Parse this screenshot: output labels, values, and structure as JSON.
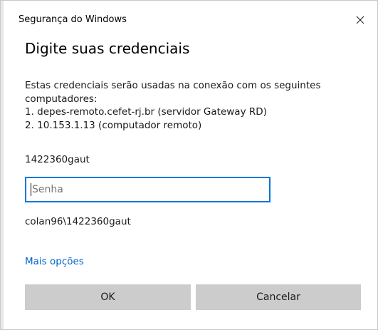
{
  "window": {
    "title": "Segurança do Windows"
  },
  "dialog": {
    "heading": "Digite suas credenciais",
    "message_lines": [
      "Estas credenciais serão usadas na conexão com os seguintes",
      "computadores:",
      "1. depes-remoto.cefet-rj.br (servidor Gateway RD)",
      "2. 10.153.1.13 (computador remoto)"
    ],
    "username": "1422360gaut",
    "password": {
      "value": "",
      "placeholder": "Senha"
    },
    "domain_user": "colan96\\1422360gaut",
    "more_options_label": "Mais opções",
    "ok_label": "OK",
    "cancel_label": "Cancelar"
  },
  "icons": {
    "close": "close-icon"
  },
  "colors": {
    "accent": "#0078d7",
    "link": "#0066cc",
    "button_bg": "#cccccc",
    "border": "#c8c8c8"
  }
}
